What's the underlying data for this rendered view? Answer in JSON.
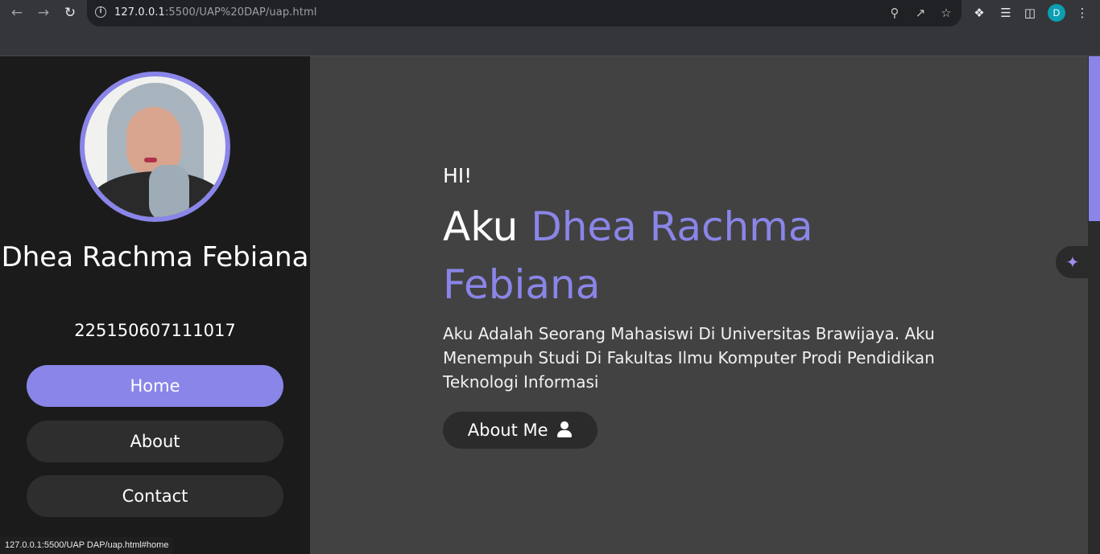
{
  "browser": {
    "url_host": "127.0.0.1",
    "url_path": ":5500/UAP%20DAP/uap.html",
    "profile_initial": "D",
    "status_url": "127.0.0.1:5500/UAP DAP/uap.html#home"
  },
  "sidebar": {
    "name": "Dhea Rachma Febiana",
    "nim": "225150607111017",
    "menu": [
      {
        "label": "Home",
        "active": true
      },
      {
        "label": "About",
        "active": false
      },
      {
        "label": "Contact",
        "active": false
      }
    ]
  },
  "hero": {
    "greeting": "HI!",
    "intro_prefix": "Aku",
    "intro_name": "Dhea Rachma Febiana",
    "description": "Aku Adalah Seorang Mahasiswi Di Universitas Brawijaya. Aku Menempuh Studi Di Fakultas Ilmu Komputer Prodi Pendidikan Teknologi Informasi",
    "about_button": "About Me"
  },
  "colors": {
    "accent": "#8a85e8",
    "sidebar_bg": "#1b1b1b",
    "main_bg": "#424242"
  }
}
